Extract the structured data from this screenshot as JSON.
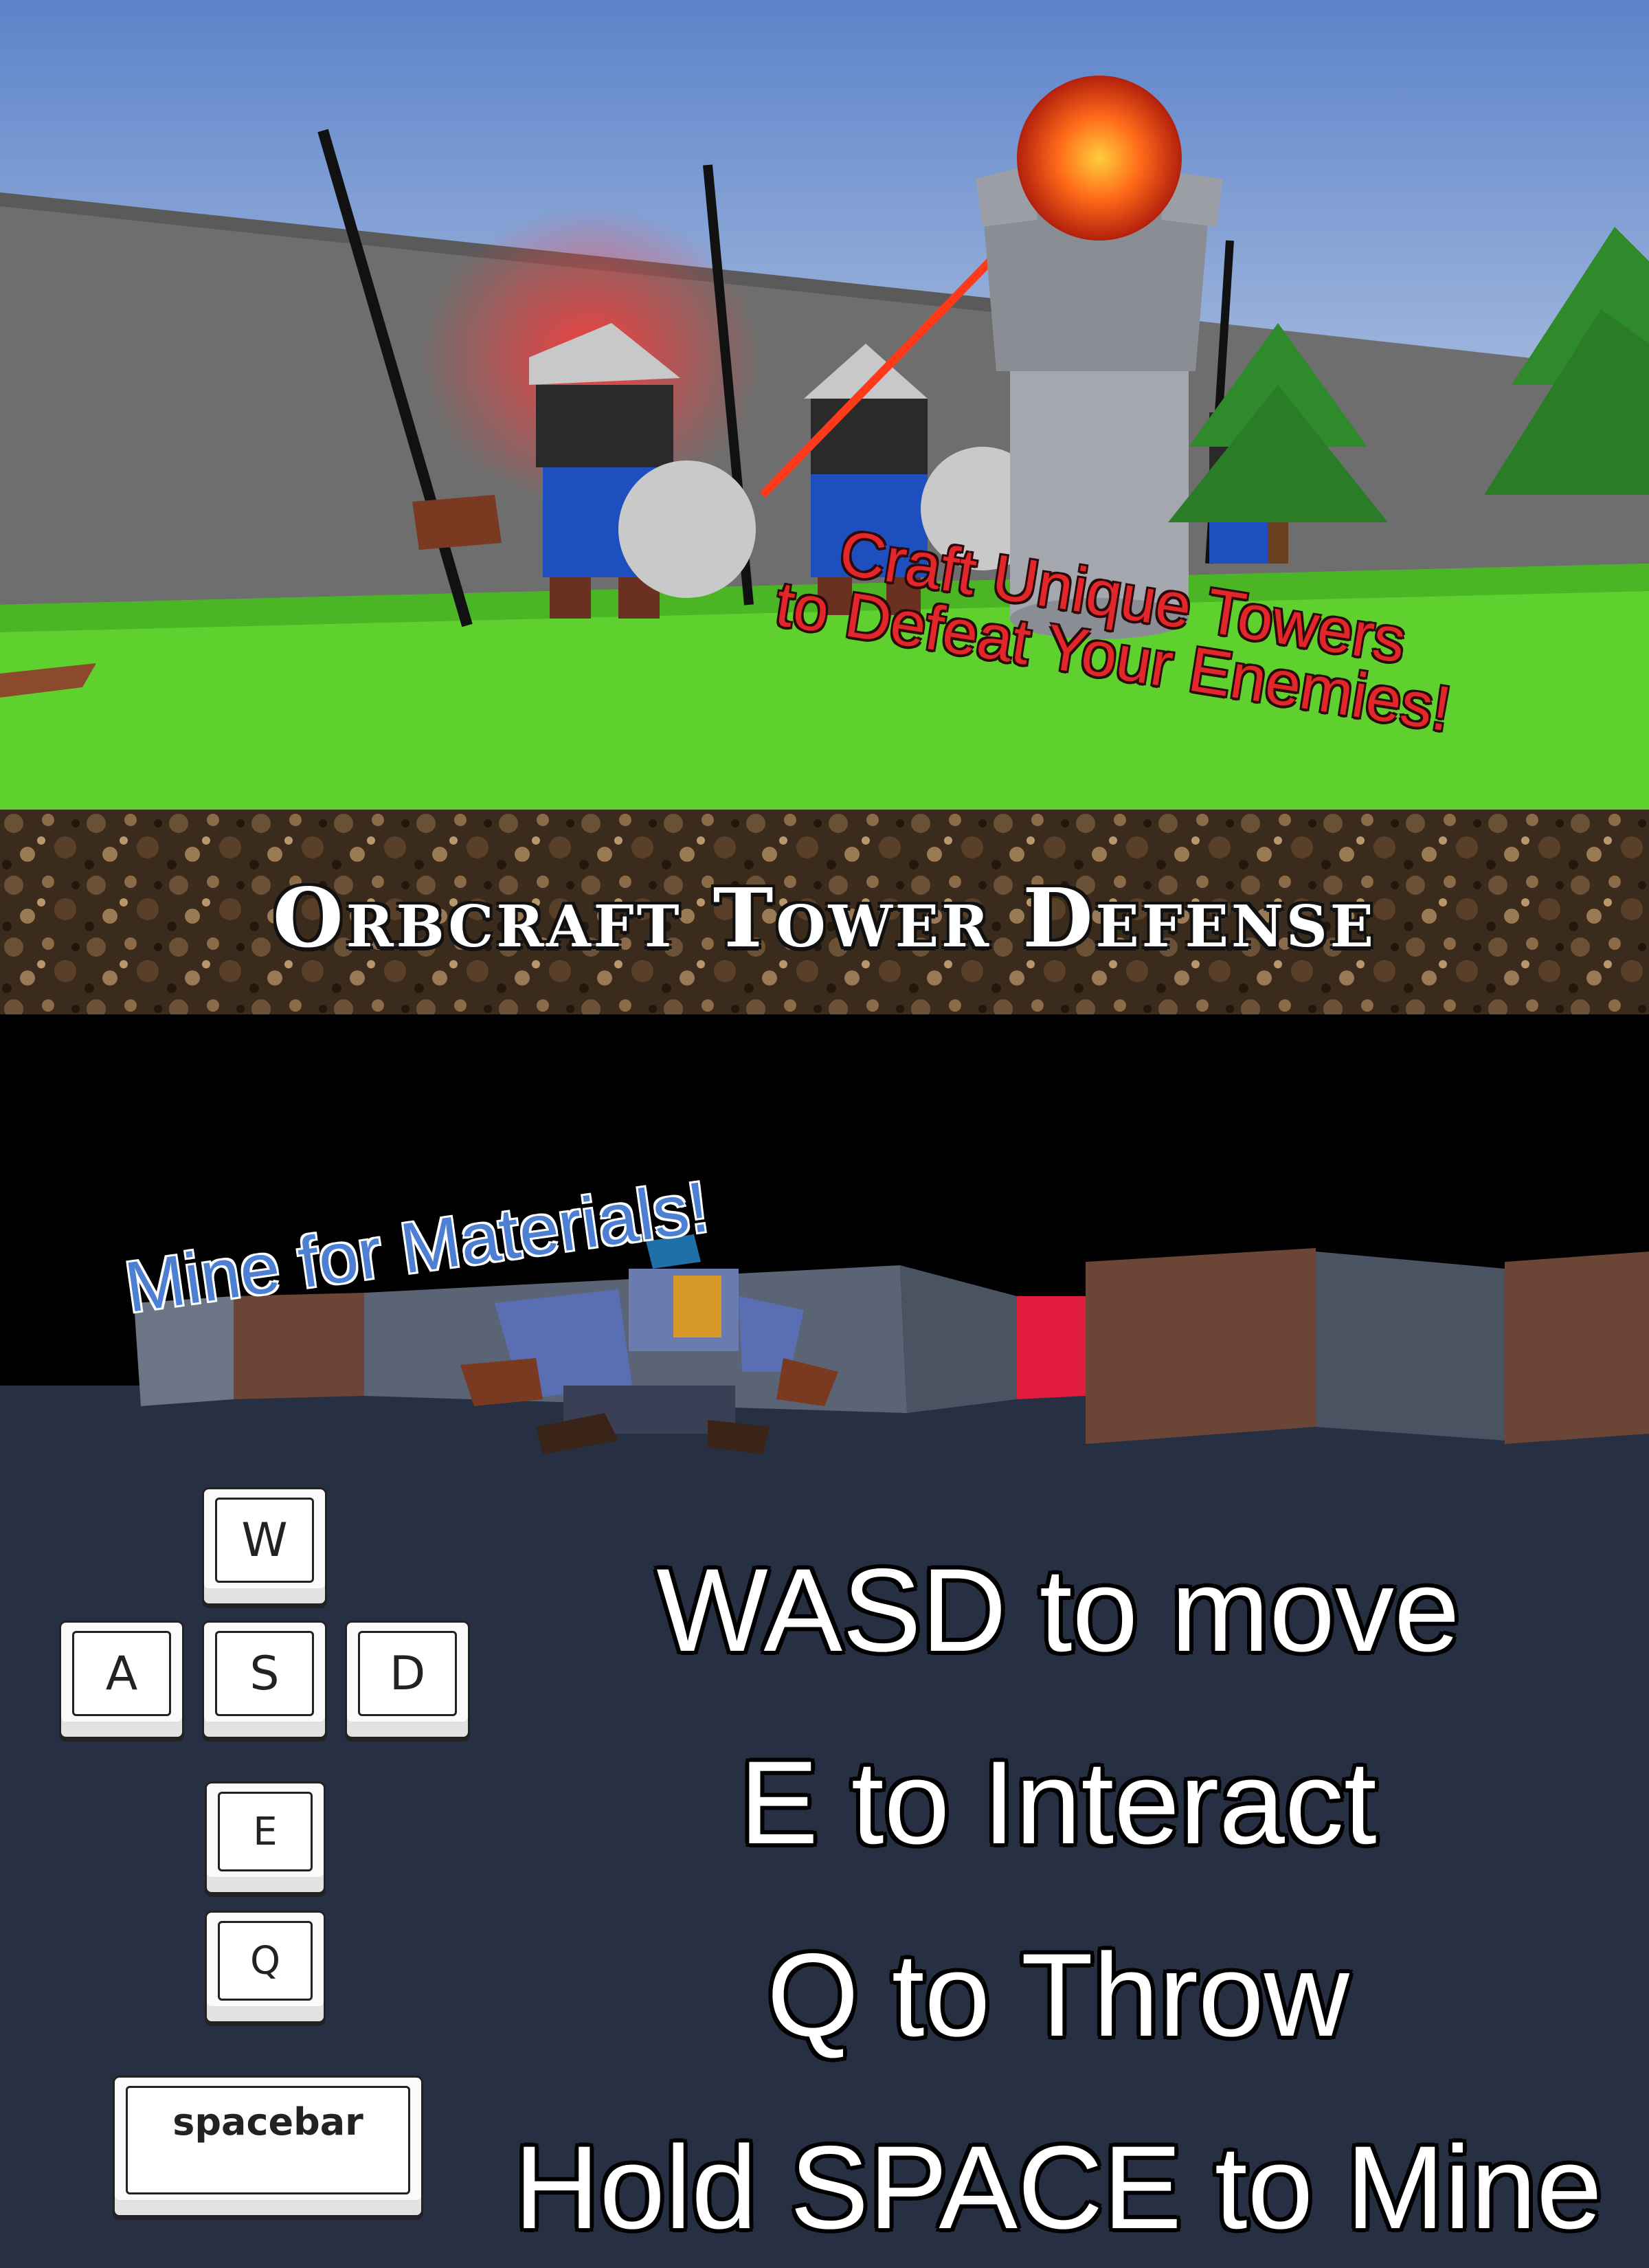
{
  "top_scene": {
    "tagline_line1": "Craft Unique Towers",
    "tagline_line2": "to Defeat Your Enemies!"
  },
  "banner": {
    "title": "Orbcraft Tower Defense"
  },
  "mine_scene": {
    "caption": "Mine for Materials!"
  },
  "controls": {
    "keys": {
      "w": "W",
      "a": "A",
      "s": "S",
      "d": "D",
      "e": "E",
      "q": "Q",
      "space": "spacebar"
    },
    "instructions": [
      "WASD to move",
      "E to Interact",
      "Q to Throw",
      "Hold SPACE to Mine"
    ]
  },
  "colors": {
    "tagline": "#e3262a",
    "mine_caption": "#4d7fd3",
    "controls_bg": "#263042",
    "grass": "#5ed12e",
    "sky_top": "#6a8fd0"
  }
}
